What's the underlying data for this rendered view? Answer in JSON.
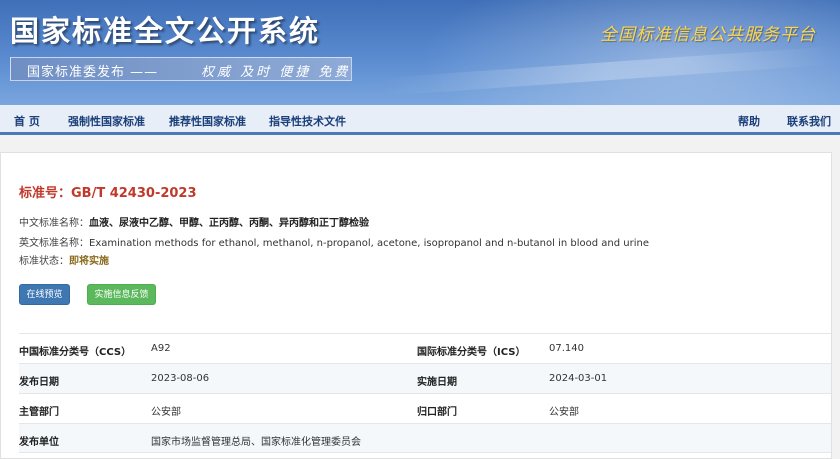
{
  "header": {
    "site_title": "国家标准全文公开系统",
    "slogan_main": "国家标准委发布 ——",
    "slogan_tail": "权威 及时 便捷 免费",
    "platform": "全国标准信息公共服务平台"
  },
  "nav": {
    "items": [
      "首 页",
      "强制性国家标准",
      "推荐性国家标准",
      "指导性技术文件"
    ],
    "help": "帮助",
    "contact": "联系我们"
  },
  "standard": {
    "number": "标准号：GB/T 42430-2023",
    "cn_name_label": "中文标准名称：",
    "cn_name": "血液、尿液中乙醇、甲醇、正丙醇、丙酮、异丙醇和正丁醇检验",
    "en_name_label": "英文标准名称：",
    "en_name": "Examination methods for ethanol, methanol, n-propanol, acetone, isopropanol and n-butanol in blood and urine",
    "status_label": "标准状态：",
    "status": "即将实施"
  },
  "buttons": {
    "preview": "在线预览",
    "feedback": "实施信息反馈"
  },
  "details": {
    "ccs_label": "中国标准分类号（CCS）",
    "ccs": "A92",
    "ics_label": "国际标准分类号（ICS）",
    "ics": "07.140",
    "pub_date_label": "发布日期",
    "pub_date": "2023-08-06",
    "impl_date_label": "实施日期",
    "impl_date": "2024-03-01",
    "dept_label": "主管部门",
    "dept": "公安部",
    "belong_label": "归口部门",
    "belong": "公安部",
    "issuer_label": "发布单位",
    "issuer": "国家市场监督管理总局、国家标准化管理委员会"
  }
}
